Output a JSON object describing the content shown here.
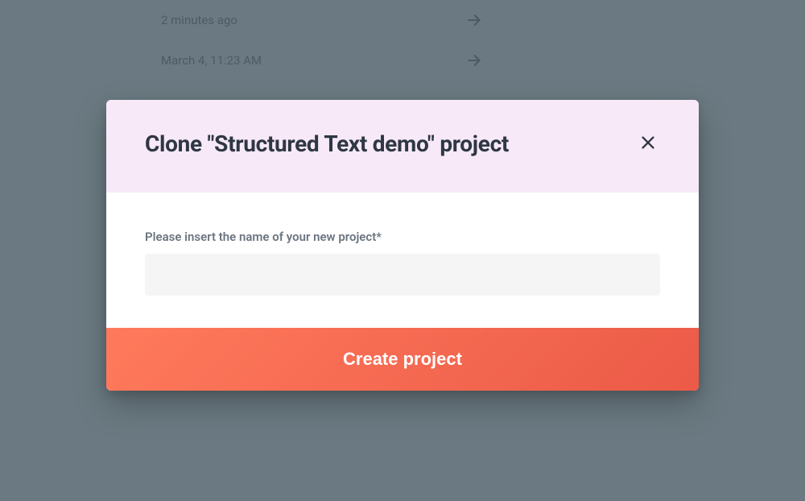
{
  "background": {
    "items": [
      {
        "label": "2 minutes ago"
      },
      {
        "label": "March 4, 11:23 AM"
      }
    ]
  },
  "modal": {
    "title": "Clone \"Structured Text demo\" project",
    "field_label": "Please insert the name of your new project*",
    "input_value": "",
    "submit_label": "Create project"
  }
}
